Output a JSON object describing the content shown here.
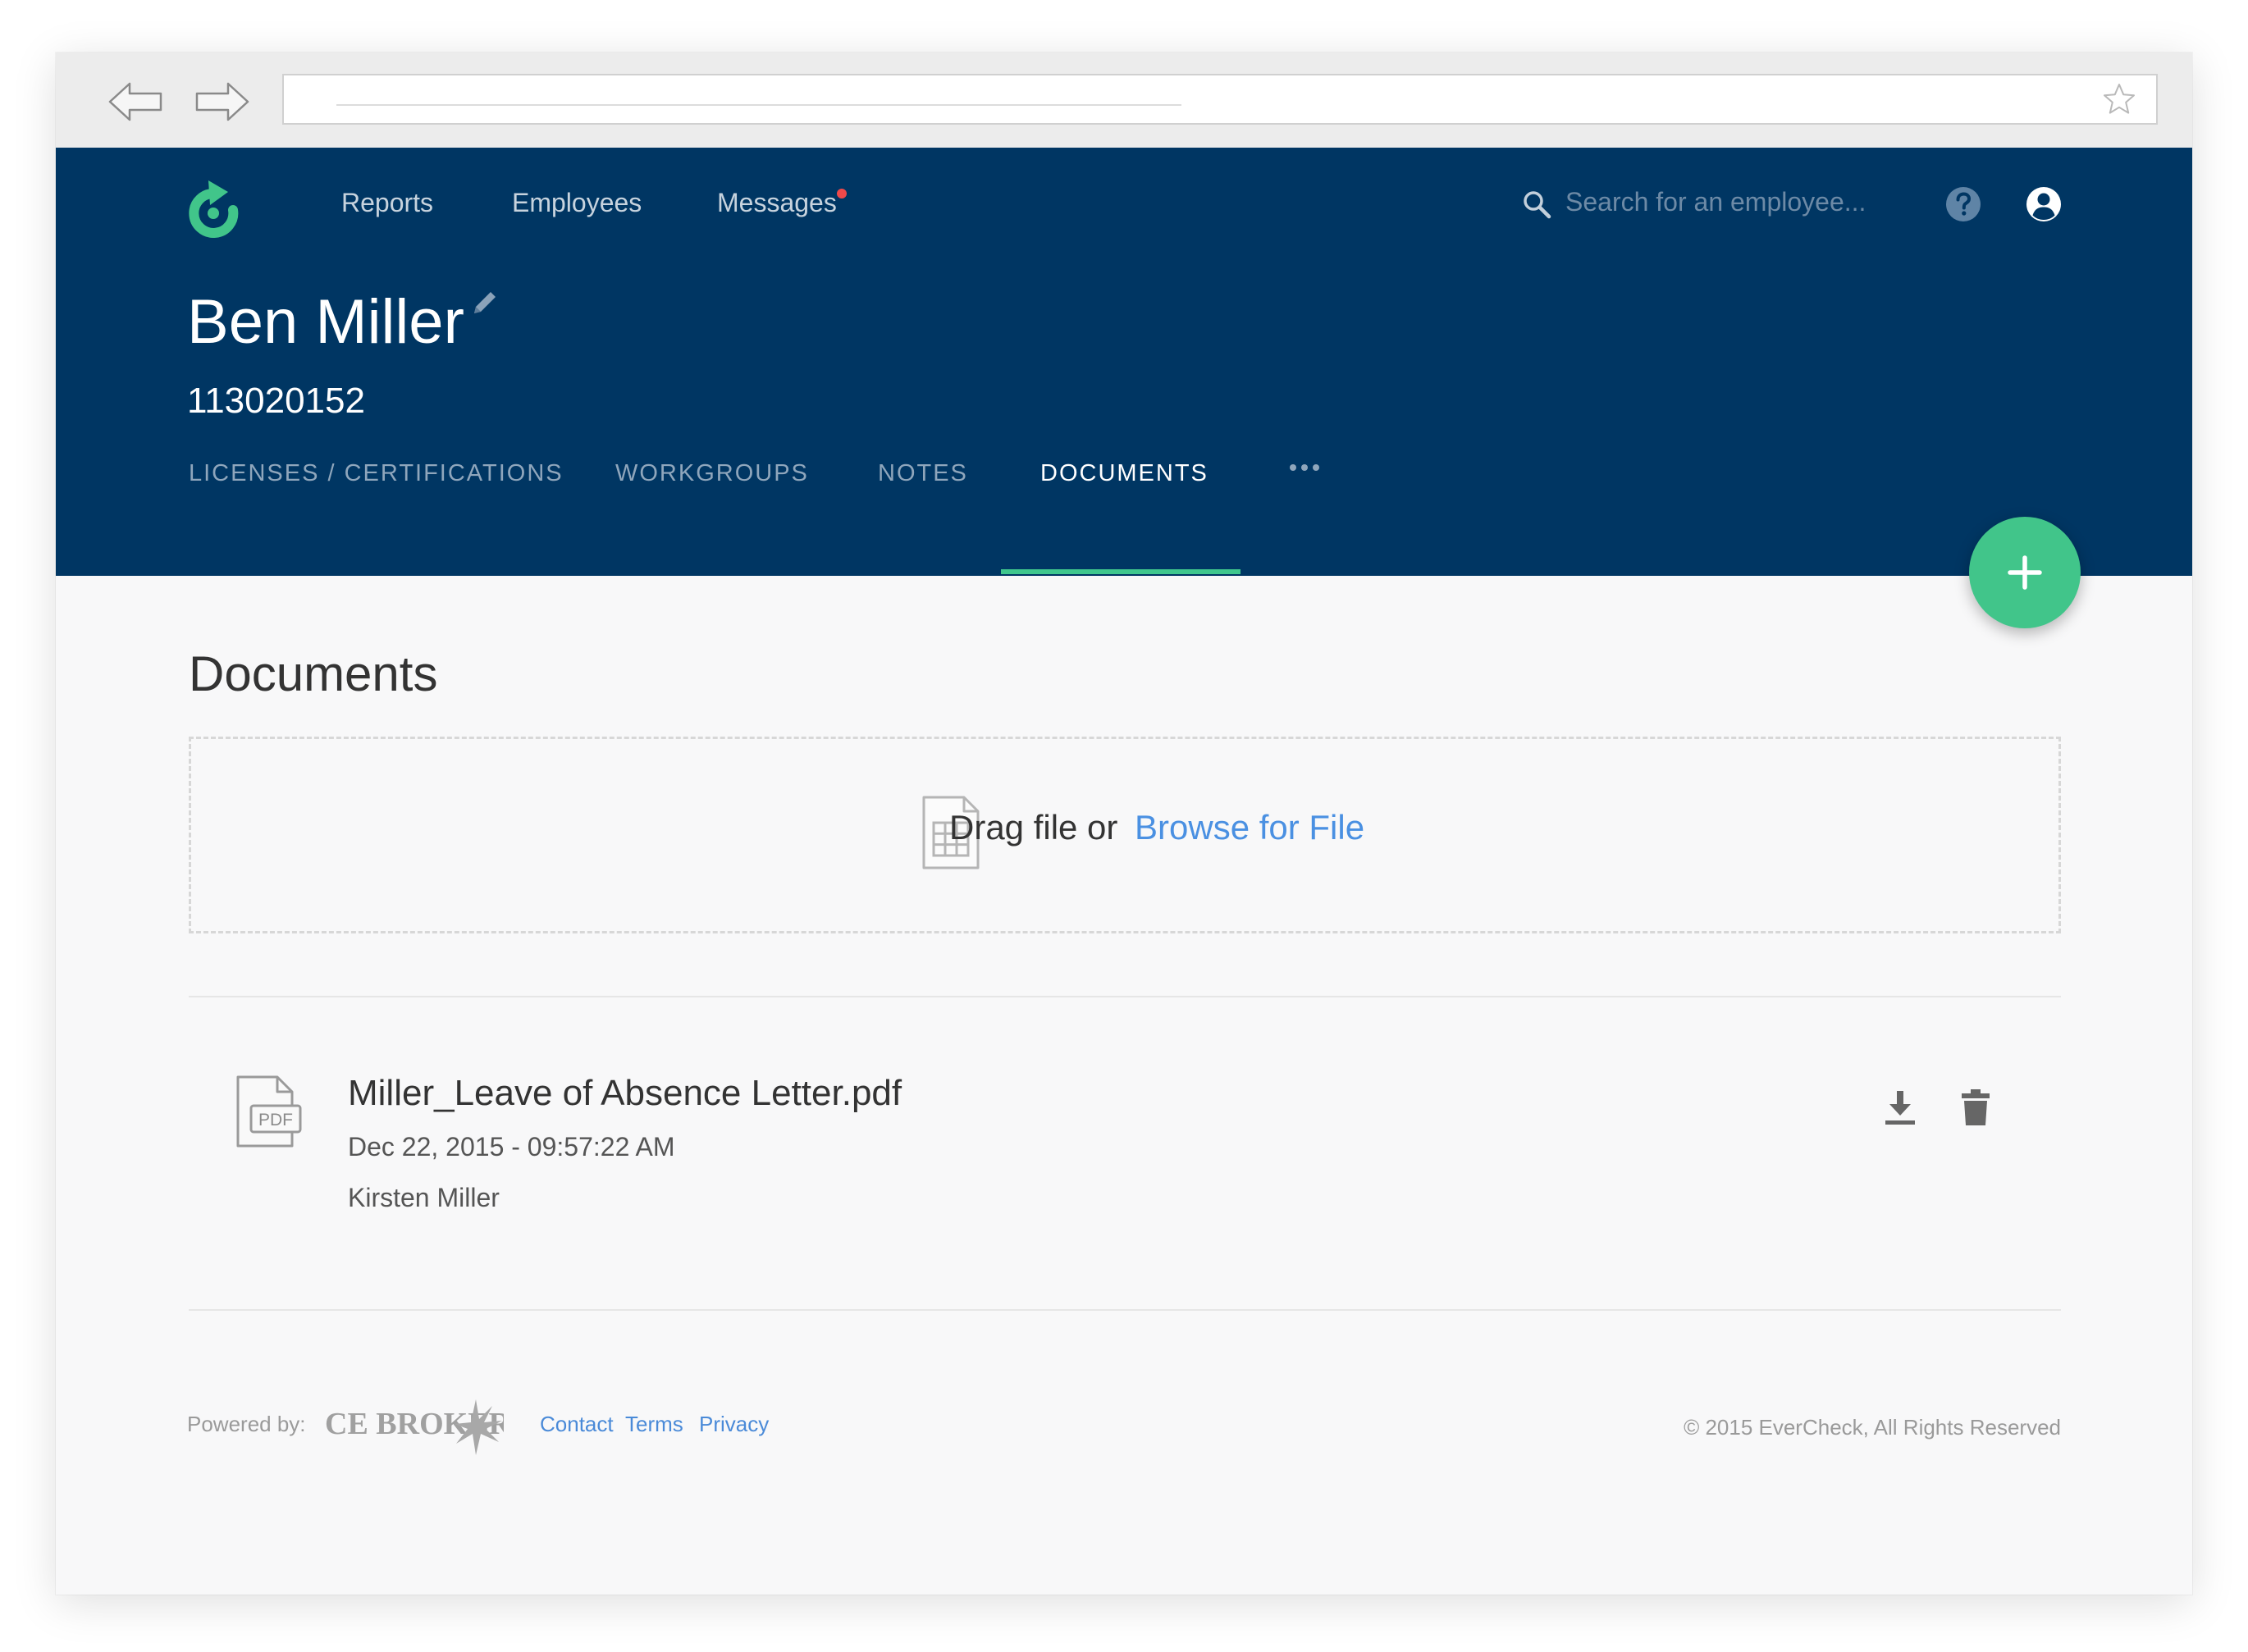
{
  "nav": {
    "reports": "Reports",
    "employees": "Employees",
    "messages": "Messages",
    "messages_unread": true
  },
  "search": {
    "placeholder": "Search for an employee..."
  },
  "employee": {
    "name": "Ben Miller",
    "id": "113020152"
  },
  "tabs": [
    {
      "label": "LICENSES / CERTIFICATIONS",
      "active": false
    },
    {
      "label": "WORKGROUPS",
      "active": false
    },
    {
      "label": "NOTES",
      "active": false
    },
    {
      "label": "DOCUMENTS",
      "active": true
    }
  ],
  "documents": {
    "title": "Documents",
    "dropzone": {
      "prefix": "Drag file or",
      "link": "Browse for File"
    },
    "items": [
      {
        "file_name": "Miller_Leave of Absence Letter.pdf",
        "date": "Dec 22, 2015 - 09:57:22 AM",
        "uploaded_by": "Kirsten Miller",
        "file_type_label": "PDF"
      }
    ]
  },
  "footer": {
    "powered_by": "Powered by:",
    "partner_logo_text": "CE BROKER",
    "links": [
      "Contact",
      "Terms",
      "Privacy"
    ],
    "copyright": "© 2015 EverCheck, All Rights Reserved"
  },
  "icons": {
    "back": "arrow-left-outline",
    "forward": "arrow-right-outline",
    "bookmark": "star-outline",
    "logo": "circular-arrow-logo",
    "search": "magnifier",
    "help": "question-circle",
    "account": "user-circle",
    "edit": "pencil",
    "more": "ellipsis",
    "add": "plus",
    "upload_file": "spreadsheet-file",
    "pdf_file": "pdf-file",
    "download": "download-arrow",
    "delete": "trash-can"
  },
  "colors": {
    "header_bg": "#003663",
    "accent_green": "#41c58a",
    "link_blue": "#4a90e2",
    "notification_red": "#f0494a",
    "page_bg": "#f8f8f9"
  }
}
